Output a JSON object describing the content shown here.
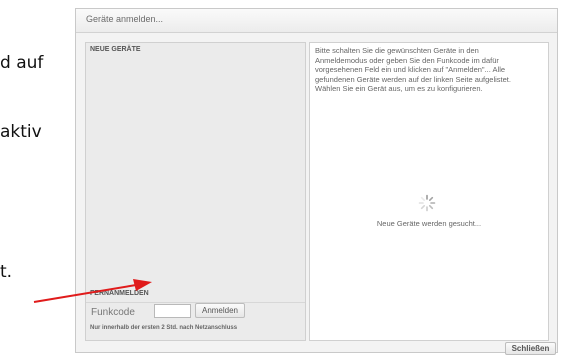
{
  "background_doc": {
    "line1": "d auf",
    "line2": "aktiv",
    "line3": "t."
  },
  "annotation": {
    "arrow_color": "#e01b1b"
  },
  "dialog": {
    "title": "Geräte anmelden...",
    "new_devices_heading": "NEUE GERÄTE",
    "remote_heading": "FERNANMELDEN",
    "funkcode_label": "Funkcode",
    "funkcode_value": "",
    "register_button": "Anmelden",
    "note": "Nur innerhalb der ersten 2 Std. nach Netzanschluss",
    "instructions": "Bitte schalten Sie die gewünschten Geräte in den Anmeldemodus oder geben Sie den Funkcode im dafür vorgesehenen Feld ein und klicken auf \"Anmelden\"... Alle gefundenen Geräte werden auf der linken Seite aufgelistet. Wählen Sie ein Gerät aus, um es zu konfigurieren.",
    "searching_text": "Neue Geräte werden gesucht...",
    "close_button": "Schließen"
  }
}
